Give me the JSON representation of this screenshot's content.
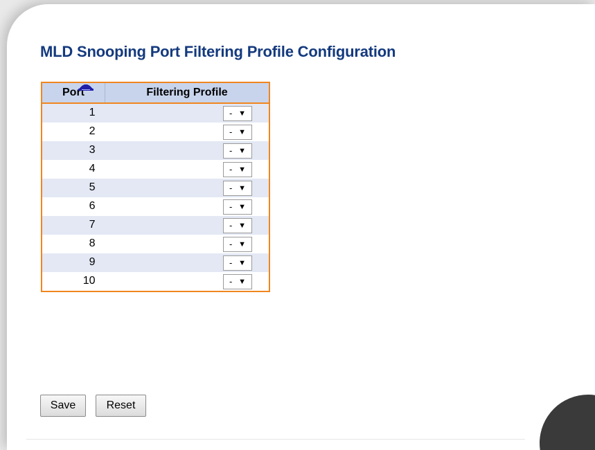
{
  "page": {
    "title": "MLD Snooping Port Filtering Profile Configuration"
  },
  "table": {
    "headers": {
      "port": "Port",
      "filtering_profile": "Filtering Profile"
    },
    "rows": [
      {
        "port": "1",
        "profile": "-"
      },
      {
        "port": "2",
        "profile": "-"
      },
      {
        "port": "3",
        "profile": "-"
      },
      {
        "port": "4",
        "profile": "-"
      },
      {
        "port": "5",
        "profile": "-"
      },
      {
        "port": "6",
        "profile": "-"
      },
      {
        "port": "7",
        "profile": "-"
      },
      {
        "port": "8",
        "profile": "-"
      },
      {
        "port": "9",
        "profile": "-"
      },
      {
        "port": "10",
        "profile": "-"
      }
    ],
    "dropdown_arrow": "▼"
  },
  "buttons": {
    "save_label": "Save",
    "reset_label": "Reset"
  },
  "colors": {
    "title": "#143a7e",
    "table_border": "#f0861e",
    "header_bg": "#c8d4ec",
    "row_alt_bg": "#e3e8f4",
    "icon": "#2020a8"
  },
  "icons": {
    "row_icon": "profile-lookup-icon"
  }
}
